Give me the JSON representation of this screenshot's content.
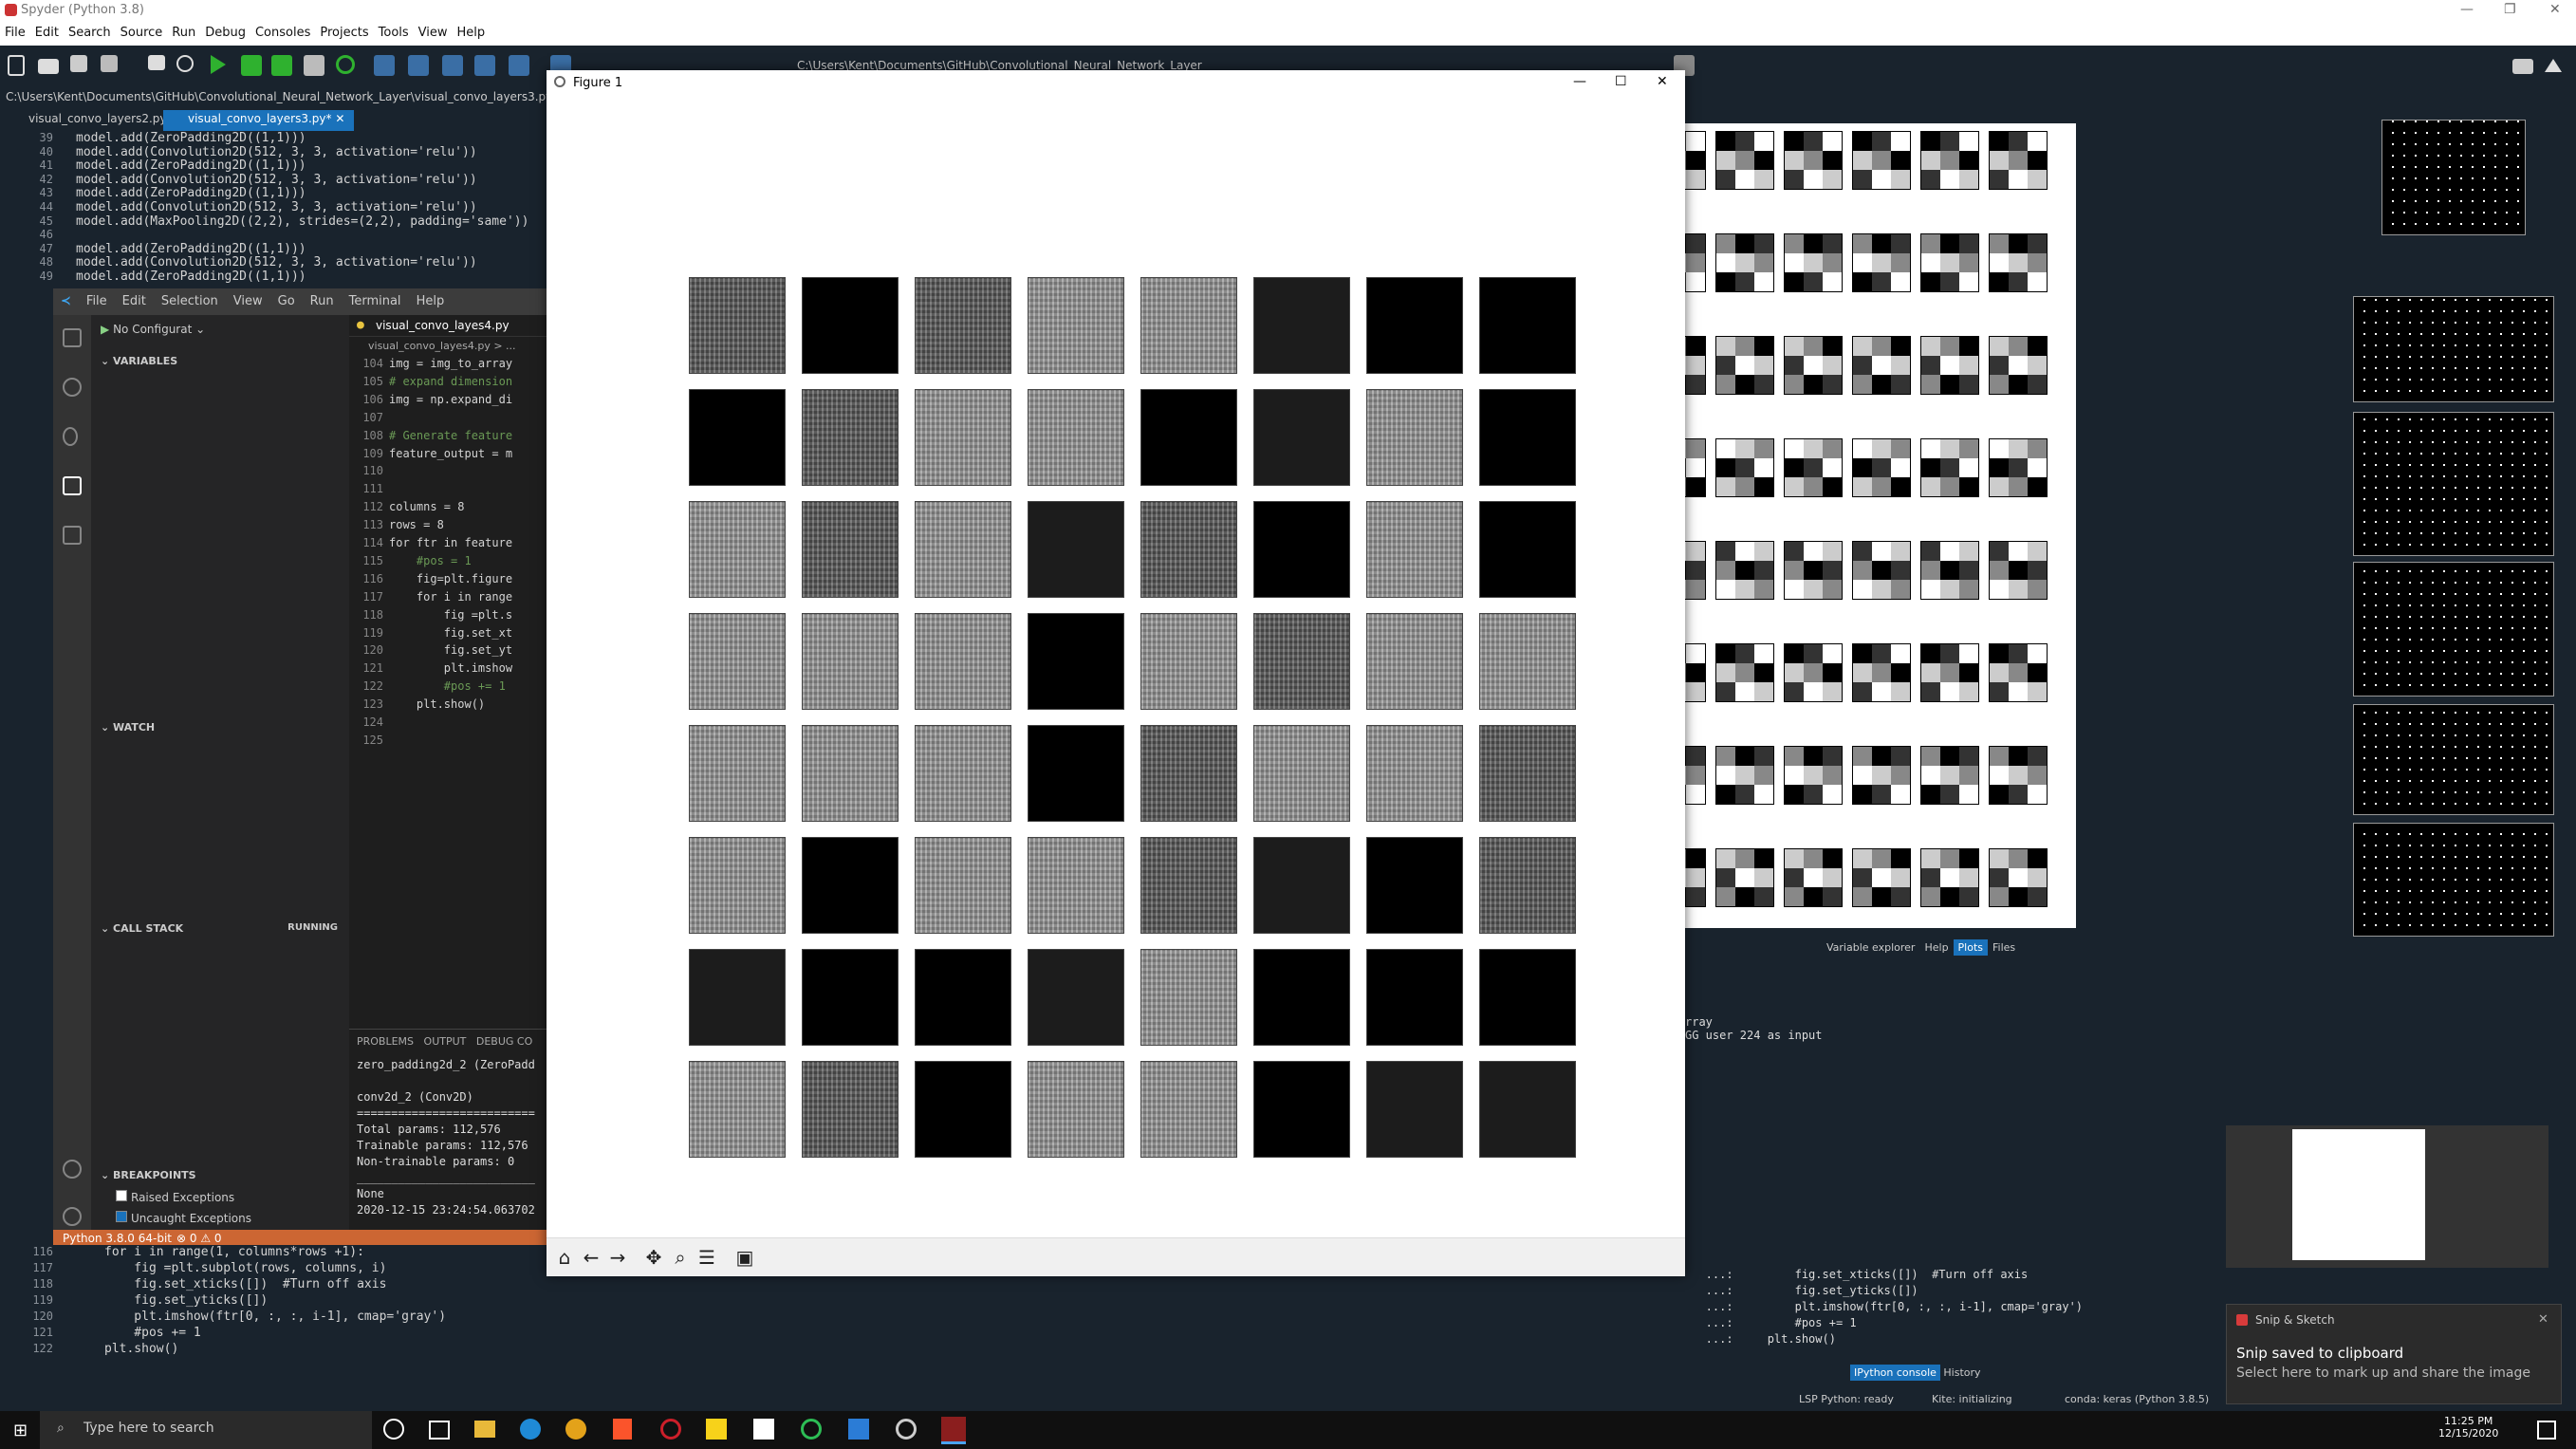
{
  "spyder": {
    "title": "Spyder (Python 3.8)",
    "menu": [
      "File",
      "Edit",
      "Search",
      "Source",
      "Run",
      "Debug",
      "Consoles",
      "Projects",
      "Tools",
      "View",
      "Help"
    ],
    "path": "C:\\Users\\Kent\\Documents\\GitHub\\Convolutional_Neural_Network_Layer\\visual_convo_layers3.py",
    "toolbar_path": "C:\\Users\\Kent\\Documents\\GitHub\\Convolutional_Neural_Network_Layer",
    "tabs": [
      "visual_convo_layers2.py",
      "visual_convo_layers3.py*"
    ],
    "editor_lines": [
      {
        "n": "39",
        "code": "model.add(ZeroPadding2D((1,1)))"
      },
      {
        "n": "40",
        "code": "model.add(Convolution2D(512, 3, 3, activation='relu'))"
      },
      {
        "n": "41",
        "code": "model.add(ZeroPadding2D((1,1)))"
      },
      {
        "n": "42",
        "code": "model.add(Convolution2D(512, 3, 3, activation='relu'))"
      },
      {
        "n": "43",
        "code": "model.add(ZeroPadding2D((1,1)))"
      },
      {
        "n": "44",
        "code": "model.add(Convolution2D(512, 3, 3, activation='relu'))"
      },
      {
        "n": "45",
        "code": "model.add(MaxPooling2D((2,2), strides=(2,2), padding='same'))"
      },
      {
        "n": "46",
        "code": ""
      },
      {
        "n": "47",
        "code": "model.add(ZeroPadding2D((1,1)))"
      },
      {
        "n": "48",
        "code": "model.add(Convolution2D(512, 3, 3, activation='relu'))"
      },
      {
        "n": "49",
        "code": "model.add(ZeroPadding2D((1,1)))"
      }
    ],
    "bottom_lines": [
      {
        "n": "116",
        "code": "for i in range(1, columns*rows +1):"
      },
      {
        "n": "117",
        "code": "    fig =plt.subplot(rows, columns, i)"
      },
      {
        "n": "118",
        "code": "    fig.set_xticks([])  #Turn off axis"
      },
      {
        "n": "119",
        "code": "    fig.set_yticks([])"
      },
      {
        "n": "120",
        "code": "    plt.imshow(ftr[0, :, :, i-1], cmap='gray')"
      },
      {
        "n": "121",
        "code": "    #pos += 1"
      },
      {
        "n": "122",
        "code": "plt.show()"
      }
    ],
    "plot_tabs": [
      "Variable explorer",
      "Help",
      "Plots",
      "Files"
    ],
    "console_tabs": [
      "IPython console",
      "History"
    ],
    "console_lines": [
      "rray",
      "GG user 224 as input"
    ],
    "console_code": [
      "   ...:         fig.set_xticks([])  #Turn off axis",
      "   ...:         fig.set_yticks([])",
      "   ...:         plt.imshow(ftr[0, :, :, i-1], cmap='gray')",
      "   ...:         #pos += 1",
      "   ...:     plt.show()"
    ],
    "status": [
      "LSP Python: ready",
      "Kite: initializing",
      "conda: keras (Python 3.8.5)"
    ]
  },
  "vscode": {
    "menu": [
      "File",
      "Edit",
      "Selection",
      "View",
      "Go",
      "Run",
      "Terminal",
      "Help"
    ],
    "run_config": "No Configurat",
    "sections": {
      "variables": "VARIABLES",
      "watch": "WATCH",
      "call_stack": "CALL STACK",
      "call_stack_state": "RUNNING",
      "breakpoints": "BREAKPOINTS"
    },
    "breakpoints": [
      {
        "label": "Raised Exceptions",
        "checked": false
      },
      {
        "label": "Uncaught Exceptions",
        "checked": true
      }
    ],
    "tab": "visual_convo_layes4.py",
    "breadcrumb": "visual_convo_layes4.py > ...",
    "code_lines": [
      {
        "n": "104",
        "code": "img = img_to_array"
      },
      {
        "n": "105",
        "code": "# expand dimension"
      },
      {
        "n": "106",
        "code": "img = np.expand_di"
      },
      {
        "n": "107",
        "code": ""
      },
      {
        "n": "108",
        "code": "# Generate feature"
      },
      {
        "n": "109",
        "code": "feature_output = m"
      },
      {
        "n": "110",
        "code": ""
      },
      {
        "n": "111",
        "code": ""
      },
      {
        "n": "112",
        "code": "columns = 8"
      },
      {
        "n": "113",
        "code": "rows = 8"
      },
      {
        "n": "114",
        "code": "for ftr in feature"
      },
      {
        "n": "115",
        "code": "    #pos = 1"
      },
      {
        "n": "116",
        "code": "    fig=plt.figure"
      },
      {
        "n": "117",
        "code": "    for i in range"
      },
      {
        "n": "118",
        "code": "        fig =plt.s"
      },
      {
        "n": "119",
        "code": "        fig.set_xt"
      },
      {
        "n": "120",
        "code": "        fig.set_yt"
      },
      {
        "n": "121",
        "code": "        plt.imshow"
      },
      {
        "n": "122",
        "code": "        #pos += 1"
      },
      {
        "n": "123",
        "code": "    plt.show()"
      },
      {
        "n": "124",
        "code": ""
      },
      {
        "n": "125",
        "code": ""
      }
    ],
    "panel_tabs": [
      "PROBLEMS",
      "OUTPUT",
      "DEBUG CO"
    ],
    "panel_lines": [
      "zero_padding2d_2 (ZeroPadd",
      "",
      "conv2d_2 (Conv2D)",
      "==========================",
      "Total params: 112,576",
      "Trainable params: 112,576",
      "Non-trainable params: 0",
      "__________________________",
      "None",
      "2020-12-15 23:24:54.063702"
    ],
    "status_python": "Python 3.8.0 64-bit",
    "status_problems": "⊗ 0 ⚠ 0"
  },
  "figure": {
    "title": "Figure 1",
    "grid": [
      [
        2,
        0,
        2,
        3,
        3,
        1,
        0,
        0
      ],
      [
        0,
        2,
        3,
        3,
        0,
        1,
        3,
        0
      ],
      [
        3,
        2,
        3,
        1,
        2,
        0,
        3,
        0
      ],
      [
        3,
        3,
        3,
        0,
        3,
        2,
        3,
        3
      ],
      [
        3,
        3,
        3,
        0,
        2,
        3,
        3,
        2
      ],
      [
        3,
        0,
        3,
        3,
        2,
        1,
        0,
        2
      ],
      [
        1,
        0,
        0,
        1,
        3,
        0,
        0,
        0
      ],
      [
        3,
        2,
        0,
        3,
        3,
        0,
        1,
        1
      ]
    ],
    "grid_colors": [
      "#000000",
      "#1c1c1c",
      "#5a5a5a",
      "#9a9a9a"
    ]
  },
  "toast": {
    "app": "Snip & Sketch",
    "title": "Snip saved to clipboard",
    "body": "Select here to mark up and share the image"
  },
  "taskbar": {
    "search_placeholder": "Type here to search",
    "time": "11:25 PM",
    "date": "12/15/2020"
  }
}
